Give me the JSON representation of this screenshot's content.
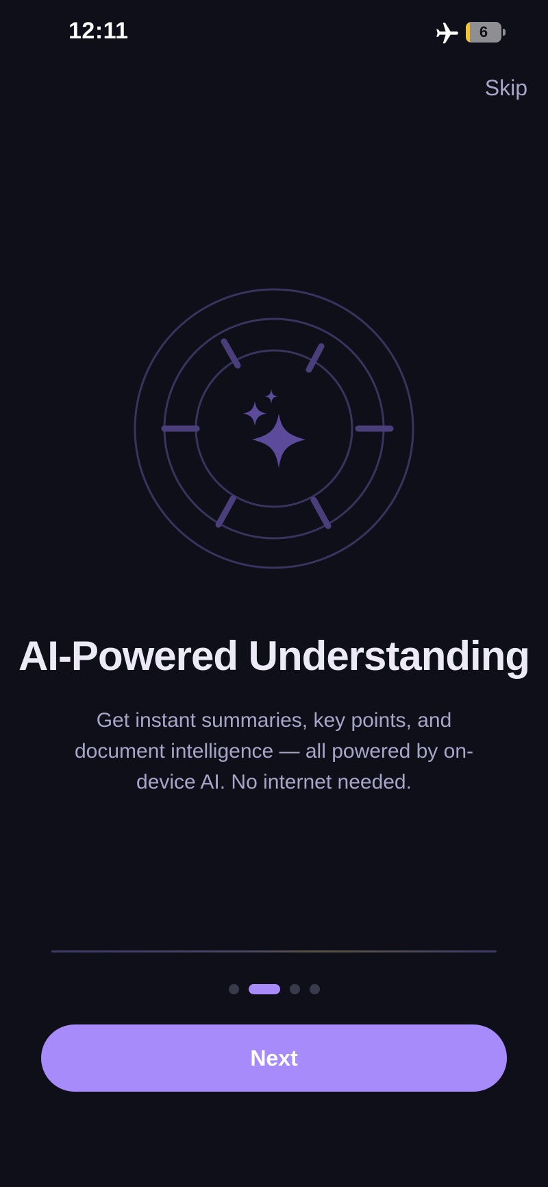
{
  "status_bar": {
    "time": "12:11",
    "battery_level": "6",
    "icons": [
      "airplane-icon",
      "battery-icon"
    ]
  },
  "header": {
    "skip_label": "Skip"
  },
  "hero": {
    "icon": "sparkles-icon"
  },
  "content": {
    "title": "AI-Powered Understanding",
    "description": "Get instant summaries, key points, and document intelligence — all powered by on-device AI. No internet needed."
  },
  "pagination": {
    "total_pages": 4,
    "current_page": 2
  },
  "footer": {
    "next_label": "Next"
  },
  "colors": {
    "background": "#0f0f1a",
    "accent": "#a78bfa",
    "text_primary": "#eceaf6",
    "text_secondary": "#a8a6c8",
    "icon_muted": "#4a3f7a"
  }
}
